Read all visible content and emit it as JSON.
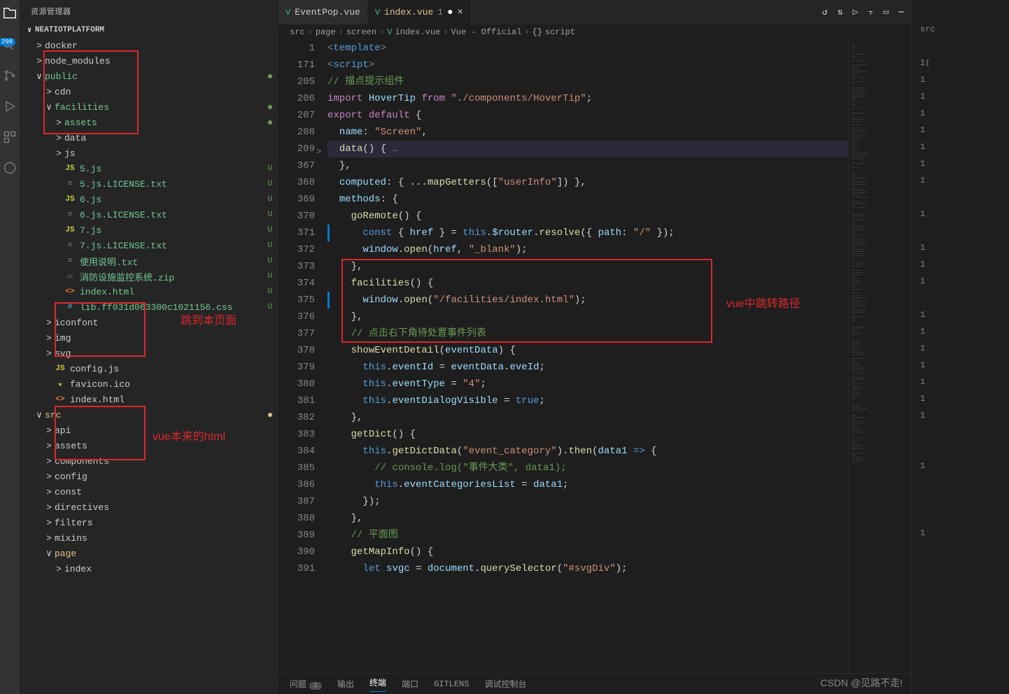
{
  "sidebar": {
    "title": "资源管理器",
    "project": "NEATIOTPLATFORM",
    "badge": "298",
    "tree": [
      {
        "depth": 1,
        "chev": ">",
        "icon": "",
        "label": "docker",
        "cls": ""
      },
      {
        "depth": 1,
        "chev": ">",
        "icon": "",
        "label": "node_modules",
        "cls": "",
        "box": "top"
      },
      {
        "depth": 1,
        "chev": "∨",
        "icon": "",
        "label": "public",
        "cls": "green-text",
        "dot": true
      },
      {
        "depth": 2,
        "chev": ">",
        "icon": "",
        "label": "cdn",
        "cls": ""
      },
      {
        "depth": 2,
        "chev": "∨",
        "icon": "",
        "label": "facilities",
        "cls": "green-text",
        "dot": true,
        "box": "bot"
      },
      {
        "depth": 3,
        "chev": ">",
        "icon": "",
        "label": "assets",
        "cls": "green-text",
        "dot": true
      },
      {
        "depth": 3,
        "chev": ">",
        "icon": "",
        "label": "data",
        "cls": ""
      },
      {
        "depth": 3,
        "chev": ">",
        "icon": "",
        "label": "js",
        "cls": ""
      },
      {
        "depth": 3,
        "chev": "",
        "icon": "JS",
        "iconcls": "ic-js",
        "label": "5.js",
        "cls": "green-text",
        "status": "U"
      },
      {
        "depth": 3,
        "chev": "",
        "icon": "≡",
        "iconcls": "ic-txt",
        "label": "5.js.LICENSE.txt",
        "cls": "green-text",
        "status": "U"
      },
      {
        "depth": 3,
        "chev": "",
        "icon": "JS",
        "iconcls": "ic-js",
        "label": "6.js",
        "cls": "green-text",
        "status": "U"
      },
      {
        "depth": 3,
        "chev": "",
        "icon": "≡",
        "iconcls": "ic-txt",
        "label": "6.js.LICENSE.txt",
        "cls": "green-text",
        "status": "U"
      },
      {
        "depth": 3,
        "chev": "",
        "icon": "JS",
        "iconcls": "ic-js",
        "label": "7.js",
        "cls": "green-text",
        "status": "U"
      },
      {
        "depth": 3,
        "chev": "",
        "icon": "≡",
        "iconcls": "ic-txt",
        "label": "7.js.LICENSE.txt",
        "cls": "green-text",
        "status": "U"
      },
      {
        "depth": 3,
        "chev": "",
        "icon": "≡",
        "iconcls": "ic-txt",
        "label": "使用说明.txt",
        "cls": "green-text",
        "status": "U"
      },
      {
        "depth": 3,
        "chev": "",
        "icon": "▭",
        "iconcls": "ic-zip",
        "label": "消防设施监控系统.zip",
        "cls": "green-text",
        "status": "U"
      },
      {
        "depth": 3,
        "chev": "",
        "icon": "<>",
        "iconcls": "ic-html",
        "label": "index.html",
        "cls": "green-text",
        "status": "U",
        "box2": "a"
      },
      {
        "depth": 3,
        "chev": "",
        "icon": "#",
        "iconcls": "ic-css",
        "label": "lib.ff031d063300c1021156.css",
        "cls": "green-text",
        "status": "U"
      },
      {
        "depth": 2,
        "chev": ">",
        "icon": "",
        "label": "iconfont",
        "cls": ""
      },
      {
        "depth": 2,
        "chev": ">",
        "icon": "",
        "label": "img",
        "cls": ""
      },
      {
        "depth": 2,
        "chev": ">",
        "icon": "",
        "label": "svg",
        "cls": ""
      },
      {
        "depth": 2,
        "chev": "",
        "icon": "JS",
        "iconcls": "ic-js",
        "label": "config.js",
        "cls": ""
      },
      {
        "depth": 2,
        "chev": "",
        "icon": "★",
        "iconcls": "ic-ico",
        "label": "favicon.ico",
        "cls": ""
      },
      {
        "depth": 2,
        "chev": "",
        "icon": "<>",
        "iconcls": "ic-html",
        "label": "index.html",
        "cls": "",
        "box2": "b"
      },
      {
        "depth": 1,
        "chev": "∨",
        "icon": "",
        "label": "src",
        "cls": "mod-text",
        "dot": true,
        "dotcls": "mod"
      },
      {
        "depth": 2,
        "chev": ">",
        "icon": "",
        "label": "api",
        "cls": ""
      },
      {
        "depth": 2,
        "chev": ">",
        "icon": "",
        "label": "assets",
        "cls": ""
      },
      {
        "depth": 2,
        "chev": ">",
        "icon": "",
        "label": "components",
        "cls": ""
      },
      {
        "depth": 2,
        "chev": ">",
        "icon": "",
        "label": "config",
        "cls": ""
      },
      {
        "depth": 2,
        "chev": ">",
        "icon": "",
        "label": "const",
        "cls": ""
      },
      {
        "depth": 2,
        "chev": ">",
        "icon": "",
        "label": "directives",
        "cls": ""
      },
      {
        "depth": 2,
        "chev": ">",
        "icon": "",
        "label": "filters",
        "cls": ""
      },
      {
        "depth": 2,
        "chev": ">",
        "icon": "",
        "label": "mixins",
        "cls": ""
      },
      {
        "depth": 2,
        "chev": "∨",
        "icon": "",
        "label": "page",
        "cls": "mod-text"
      },
      {
        "depth": 3,
        "chev": ">",
        "icon": "",
        "label": "index",
        "cls": ""
      }
    ]
  },
  "tabs": [
    {
      "icon": "V",
      "label": "EventPop.vue",
      "active": false,
      "modified": false
    },
    {
      "icon": "V",
      "label": "index.vue",
      "suffix": "1",
      "active": true,
      "modified": true
    }
  ],
  "breadcrumb": [
    "src",
    "page",
    "screen",
    "index.vue",
    "Vue - Official",
    "script"
  ],
  "breadcrumb_icons": [
    "",
    "",
    "",
    "V",
    "",
    "{}"
  ],
  "lines": [
    {
      "n": "1",
      "html": "<span class='tk-tag'>&lt;</span><span class='tk-tagname'>template</span><span class='tk-tag'>&gt;</span>"
    },
    {
      "n": "171",
      "html": "<span class='tk-tag'>&lt;</span><span class='tk-tagname'>script</span><span class='tk-tag'>&gt;</span>"
    },
    {
      "n": "205",
      "html": "<span class='tk-comment'>// 描点提示组件</span>"
    },
    {
      "n": "206",
      "html": "<span class='tk-kw'>import</span> <span class='tk-var'>HoverTip</span> <span class='tk-kw'>from</span> <span class='tk-str'>\"./components/HoverTip\"</span><span class='tk-punc'>;</span>"
    },
    {
      "n": "207",
      "html": "<span class='tk-kw'>export</span> <span class='tk-kw'>default</span> <span class='tk-punc'>{</span>"
    },
    {
      "n": "208",
      "html": "  <span class='tk-prop'>name</span><span class='tk-punc'>:</span> <span class='tk-str'>\"Screen\"</span><span class='tk-punc'>,</span>"
    },
    {
      "n": "209",
      "html": "  <span class='tk-fn'>data</span><span class='tk-punc'>()</span> <span class='tk-punc'>{</span><span class='tk-tag'> …</span>",
      "hl": true,
      "fold": true
    },
    {
      "n": "367",
      "html": "  <span class='tk-punc'>},</span>"
    },
    {
      "n": "368",
      "html": "  <span class='tk-prop'>computed</span><span class='tk-punc'>:</span> <span class='tk-punc'>{</span> <span class='tk-punc'>...</span><span class='tk-fn'>mapGetters</span><span class='tk-punc'>([</span><span class='tk-str'>\"userInfo\"</span><span class='tk-punc'>])</span> <span class='tk-punc'>},</span>"
    },
    {
      "n": "369",
      "html": "  <span class='tk-prop'>methods</span><span class='tk-punc'>:</span> <span class='tk-punc'>{</span>"
    },
    {
      "n": "370",
      "html": "    <span class='tk-fn'>goRemote</span><span class='tk-punc'>()</span> <span class='tk-punc'>{</span>"
    },
    {
      "n": "371",
      "html": "      <span class='tk-blue'>const</span> <span class='tk-punc'>{</span> <span class='tk-var'>href</span> <span class='tk-punc'>}</span> <span class='tk-punc'>=</span> <span class='tk-blue'>this</span><span class='tk-punc'>.</span><span class='tk-var'>$router</span><span class='tk-punc'>.</span><span class='tk-fn'>resolve</span><span class='tk-punc'>({</span> <span class='tk-prop'>path</span><span class='tk-punc'>:</span> <span class='tk-str'>\"/\"</span> <span class='tk-punc'>});</span>",
      "bar": true
    },
    {
      "n": "372",
      "html": "      <span class='tk-var'>window</span><span class='tk-punc'>.</span><span class='tk-fn'>open</span><span class='tk-punc'>(</span><span class='tk-var'>href</span><span class='tk-punc'>,</span> <span class='tk-str'>\"_blank\"</span><span class='tk-punc'>);</span>"
    },
    {
      "n": "373",
      "html": "    <span class='tk-punc'>},</span>"
    },
    {
      "n": "374",
      "html": "    <span class='tk-fn'>facilities</span><span class='tk-punc'>()</span> <span class='tk-punc'>{</span>"
    },
    {
      "n": "375",
      "html": "      <span class='tk-var'>window</span><span class='tk-punc'>.</span><span class='tk-fn'>open</span><span class='tk-punc'>(</span><span class='tk-str'>\"/facilities/index.html\"</span><span class='tk-punc'>);</span>",
      "bar": true
    },
    {
      "n": "376",
      "html": "    <span class='tk-punc'>},</span>"
    },
    {
      "n": "377",
      "html": "    <span class='tk-comment'>// 点击右下角待处置事件列表</span>"
    },
    {
      "n": "378",
      "html": "    <span class='tk-fn'>showEventDetail</span><span class='tk-punc'>(</span><span class='tk-var'>eventData</span><span class='tk-punc'>)</span> <span class='tk-punc'>{</span>"
    },
    {
      "n": "379",
      "html": "      <span class='tk-blue'>this</span><span class='tk-punc'>.</span><span class='tk-var'>eventId</span> <span class='tk-punc'>=</span> <span class='tk-var'>eventData</span><span class='tk-punc'>.</span><span class='tk-var'>eveId</span><span class='tk-punc'>;</span>"
    },
    {
      "n": "380",
      "html": "      <span class='tk-blue'>this</span><span class='tk-punc'>.</span><span class='tk-var'>eventType</span> <span class='tk-punc'>=</span> <span class='tk-str'>\"4\"</span><span class='tk-punc'>;</span>"
    },
    {
      "n": "381",
      "html": "      <span class='tk-blue'>this</span><span class='tk-punc'>.</span><span class='tk-var'>eventDialogVisible</span> <span class='tk-punc'>=</span> <span class='tk-blue'>true</span><span class='tk-punc'>;</span>"
    },
    {
      "n": "382",
      "html": "    <span class='tk-punc'>},</span>"
    },
    {
      "n": "383",
      "html": "    <span class='tk-fn'>getDict</span><span class='tk-punc'>()</span> <span class='tk-punc'>{</span>"
    },
    {
      "n": "384",
      "html": "      <span class='tk-blue'>this</span><span class='tk-punc'>.</span><span class='tk-fn'>getDictData</span><span class='tk-punc'>(</span><span class='tk-str'>\"event_category\"</span><span class='tk-punc'>).</span><span class='tk-fn'>then</span><span class='tk-punc'>(</span><span class='tk-var'>data1</span> <span class='tk-blue'>=&gt;</span> <span class='tk-punc'>{</span>"
    },
    {
      "n": "385",
      "html": "        <span class='tk-comment'>// console.log(\"事件大类\", data1);</span>"
    },
    {
      "n": "386",
      "html": "        <span class='tk-blue'>this</span><span class='tk-punc'>.</span><span class='tk-var'>eventCategoriesList</span> <span class='tk-punc'>=</span> <span class='tk-var'>data1</span><span class='tk-punc'>;</span>"
    },
    {
      "n": "387",
      "html": "      <span class='tk-punc'>});</span>"
    },
    {
      "n": "388",
      "html": "    <span class='tk-punc'>},</span>"
    },
    {
      "n": "389",
      "html": "    <span class='tk-comment'>// 平面图</span>"
    },
    {
      "n": "390",
      "html": "    <span class='tk-fn'>getMapInfo</span><span class='tk-punc'>()</span> <span class='tk-punc'>{</span>"
    },
    {
      "n": "391",
      "html": "      <span class='tk-blue'>let</span> <span class='tk-var'>svgc</span> <span class='tk-punc'>=</span> <span class='tk-var'>document</span><span class='tk-punc'>.</span><span class='tk-fn'>querySelector</span><span class='tk-punc'>(</span><span class='tk-str'>\"#svgDiv\"</span><span class='tk-punc'>);</span>"
    }
  ],
  "right_gutter": [
    "src",
    "",
    "1(",
    "1",
    "1",
    "1",
    "1",
    "1",
    "1",
    "1",
    "",
    "1",
    "",
    "1",
    "1",
    "1",
    "",
    "1",
    "1",
    "1",
    "1",
    "1",
    "1",
    "1",
    "",
    "",
    "1",
    "",
    "",
    "",
    "1"
  ],
  "terminal": {
    "tabs": [
      "问题",
      "输出",
      "终端",
      "端口",
      "GITLENS",
      "调试控制台"
    ],
    "active": 2,
    "badge": "1"
  },
  "annotations": {
    "a1": "跳到本页面",
    "a2": "vue本来的html",
    "a3": "vue中跳转路径"
  },
  "watermark": "CSDN @见路不走!"
}
